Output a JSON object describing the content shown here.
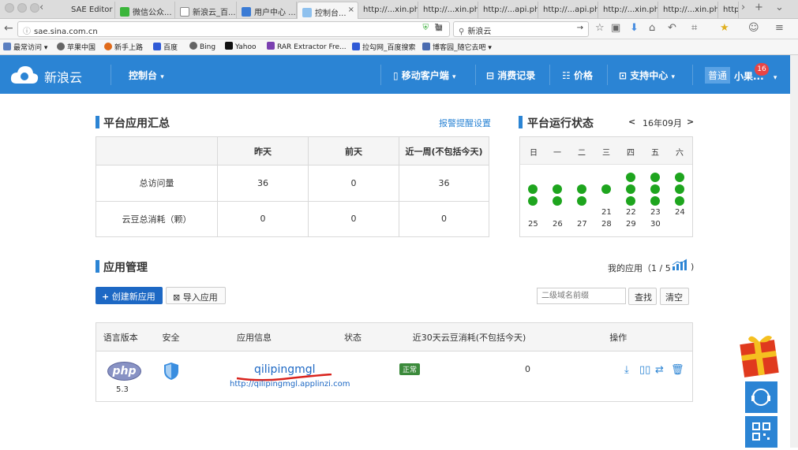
{
  "tabs": [
    "SAE Editor",
    "微信公众...",
    "新浪云_百...",
    "用户中心 ...",
    "控制台...",
    "http://...xin.php",
    "http://...xin.php",
    "http://...api.php",
    "http://...api.php",
    "http://...xin.php",
    "http://...xin.php",
    "http://"
  ],
  "tab_close": "×",
  "nav": {
    "url": "sae.sina.com.cn",
    "search": "新浪云"
  },
  "bookmarks": [
    "最常访问",
    "苹果中国",
    "新手上路",
    "百度",
    "Bing",
    "Yahoo",
    "RAR Extractor Fre...",
    "拉勾网_百度搜索",
    "博客园_随它去吧"
  ],
  "header": {
    "logo": "新浪云",
    "console": "控制台",
    "mobile": "移动客户端",
    "billing": "消费记录",
    "price": "价格",
    "support": "支持中心",
    "level": "普通",
    "user": "小果...",
    "badge": "16"
  },
  "summary": {
    "title": "平台应用汇总",
    "alert_link": "报警提醒设置",
    "columns": [
      "",
      "昨天",
      "前天",
      "近一周(不包括今天)"
    ],
    "rows": [
      [
        "总访问量",
        "36",
        "0",
        "36"
      ],
      [
        "云豆总消耗（颗）",
        "0",
        "0",
        "0"
      ]
    ]
  },
  "status": {
    "title": "平台运行状态",
    "prev": "<",
    "month": "16年09月",
    "next": ">",
    "weekdays": [
      "日",
      "一",
      "二",
      "三",
      "四",
      "五",
      "六"
    ],
    "days": [
      25,
      26,
      27,
      28,
      29,
      30,
      21,
      22,
      23,
      24
    ]
  },
  "apps": {
    "title": "应用管理",
    "my_apps": "我的应用",
    "count": "（1 / 5",
    "create": "创建新应用",
    "import": "导入应用",
    "search_placeholder": "二级域名前缀",
    "search_btn": "查找",
    "clear_btn": "清空",
    "columns": [
      "语言版本",
      "安全",
      "应用信息",
      "状态",
      "近30天云豆消耗(不包括今天)",
      "操作"
    ],
    "row": {
      "lang": "php",
      "version": "5.3",
      "name": "qilipingmgl",
      "url": "http://qilipingmgl.applinzi.com",
      "status": "正常",
      "beans": "0"
    }
  },
  "colors": {
    "primary": "#2b84d4",
    "status_ok": "#1ea51e"
  }
}
